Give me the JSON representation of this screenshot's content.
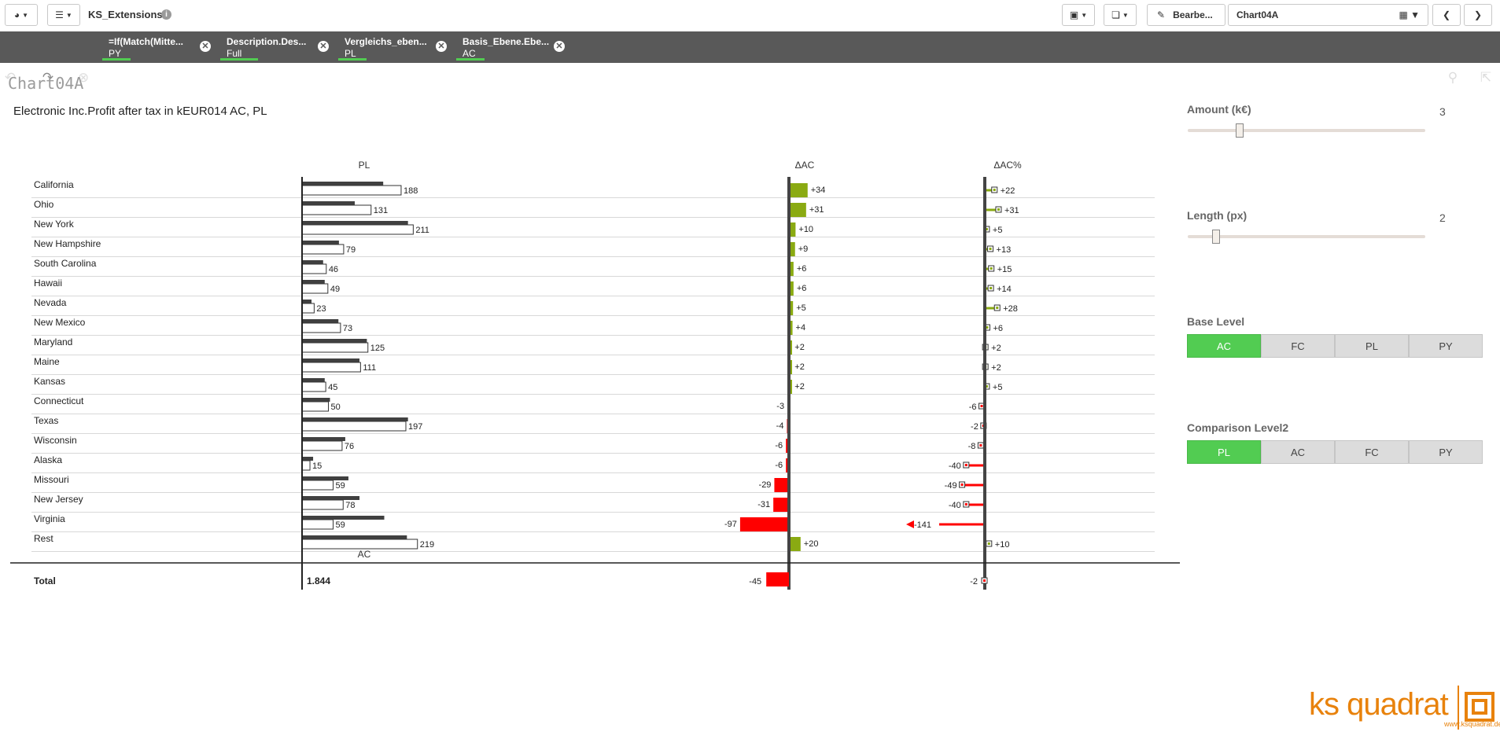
{
  "app": {
    "title": "KS_Extensions",
    "edit_label": "Bearbe...",
    "sheet_name": "Chart04A"
  },
  "selections": [
    {
      "field": "=If(Match(Mitte...",
      "value": "PY"
    },
    {
      "field": "Description.Des...",
      "value": "Full"
    },
    {
      "field": "Vergleichs_eben...",
      "value": "PL"
    },
    {
      "field": "Basis_Ebene.Ebe...",
      "value": "AC"
    }
  ],
  "sheet": {
    "title": "Chart04A"
  },
  "chart": {
    "title": "Electronic Inc.Profit after tax in kEUR014 AC, PL"
  },
  "chart_data": {
    "type": "bar",
    "column_headers": {
      "pl": "PL",
      "dac": "ΔAC",
      "dacp": "ΔAC%",
      "ac_axis": "AC"
    },
    "categories": [
      "California",
      "Ohio",
      "New York",
      "New Hampshire",
      "South Carolina",
      "Hawaii",
      "Nevada",
      "New Mexico",
      "Maryland",
      "Maine",
      "Kansas",
      "Connecticut",
      "Texas",
      "Wisconsin",
      "Alaska",
      "Missouri",
      "New Jersey",
      "Virginia",
      "Rest"
    ],
    "series": [
      {
        "name": "PL",
        "values": [
          188,
          131,
          211,
          79,
          46,
          49,
          23,
          73,
          125,
          111,
          45,
          50,
          197,
          76,
          15,
          59,
          78,
          59,
          219
        ]
      },
      {
        "name": "AC",
        "values": [
          154,
          100,
          201,
          70,
          40,
          43,
          18,
          69,
          123,
          109,
          43,
          53,
          201,
          82,
          21,
          88,
          109,
          156,
          199
        ]
      },
      {
        "name": "ΔAC",
        "values": [
          34,
          31,
          10,
          9,
          6,
          6,
          5,
          4,
          2,
          2,
          2,
          -3,
          -4,
          -6,
          -6,
          -29,
          -31,
          -97,
          20
        ]
      },
      {
        "name": "ΔAC%",
        "values": [
          22,
          31,
          5,
          13,
          15,
          14,
          28,
          6,
          2,
          2,
          5,
          -6,
          -2,
          -8,
          -40,
          -49,
          -40,
          -141,
          10
        ]
      }
    ],
    "pl_labels": [
      "188",
      "131",
      "211",
      "79",
      "46",
      "49",
      "23",
      "73",
      "125",
      "111",
      "45",
      "50",
      "197",
      "76",
      "15",
      "59",
      "78",
      "59",
      "219"
    ],
    "dac_labels": [
      "+34",
      "+31",
      "+10",
      "+9",
      "+6",
      "+6",
      "+5",
      "+4",
      "+2",
      "+2",
      "+2",
      "-3",
      "-4",
      "-6",
      "-6",
      "-29",
      "-31",
      "-97",
      "+20"
    ],
    "dacp_labels": [
      "+22",
      "+31",
      "+5",
      "+13",
      "+15",
      "+14",
      "+28",
      "+6",
      "+2",
      "+2",
      "+5",
      "-6",
      "-2",
      "-8",
      "-40",
      "-49",
      "-40",
      "-141",
      "+10"
    ],
    "total": {
      "label": "Total",
      "pl": "1.844",
      "dac": -45,
      "dac_label": "-45",
      "dacp": -2,
      "dacp_label": "-2"
    },
    "colors": {
      "positive": "#8aaa12",
      "negative": "#ff0000",
      "ac": "#404040",
      "pl_outline": "#333333"
    }
  },
  "panel": {
    "amount": {
      "label": "Amount (k€)",
      "value": "3",
      "level": 0.22
    },
    "length": {
      "label": "Length (px)",
      "value": "2",
      "level": 0.12
    },
    "base_level": {
      "label": "Base Level",
      "options": [
        "AC",
        "FC",
        "PL",
        "PY"
      ],
      "selected": "AC"
    },
    "comparison_level": {
      "label": "Comparison Level2",
      "options": [
        "PL",
        "AC",
        "FC",
        "PY"
      ],
      "selected": "PL"
    }
  },
  "logo": {
    "text": "ks quadrat",
    "url": "www.ksquadrat.de"
  }
}
